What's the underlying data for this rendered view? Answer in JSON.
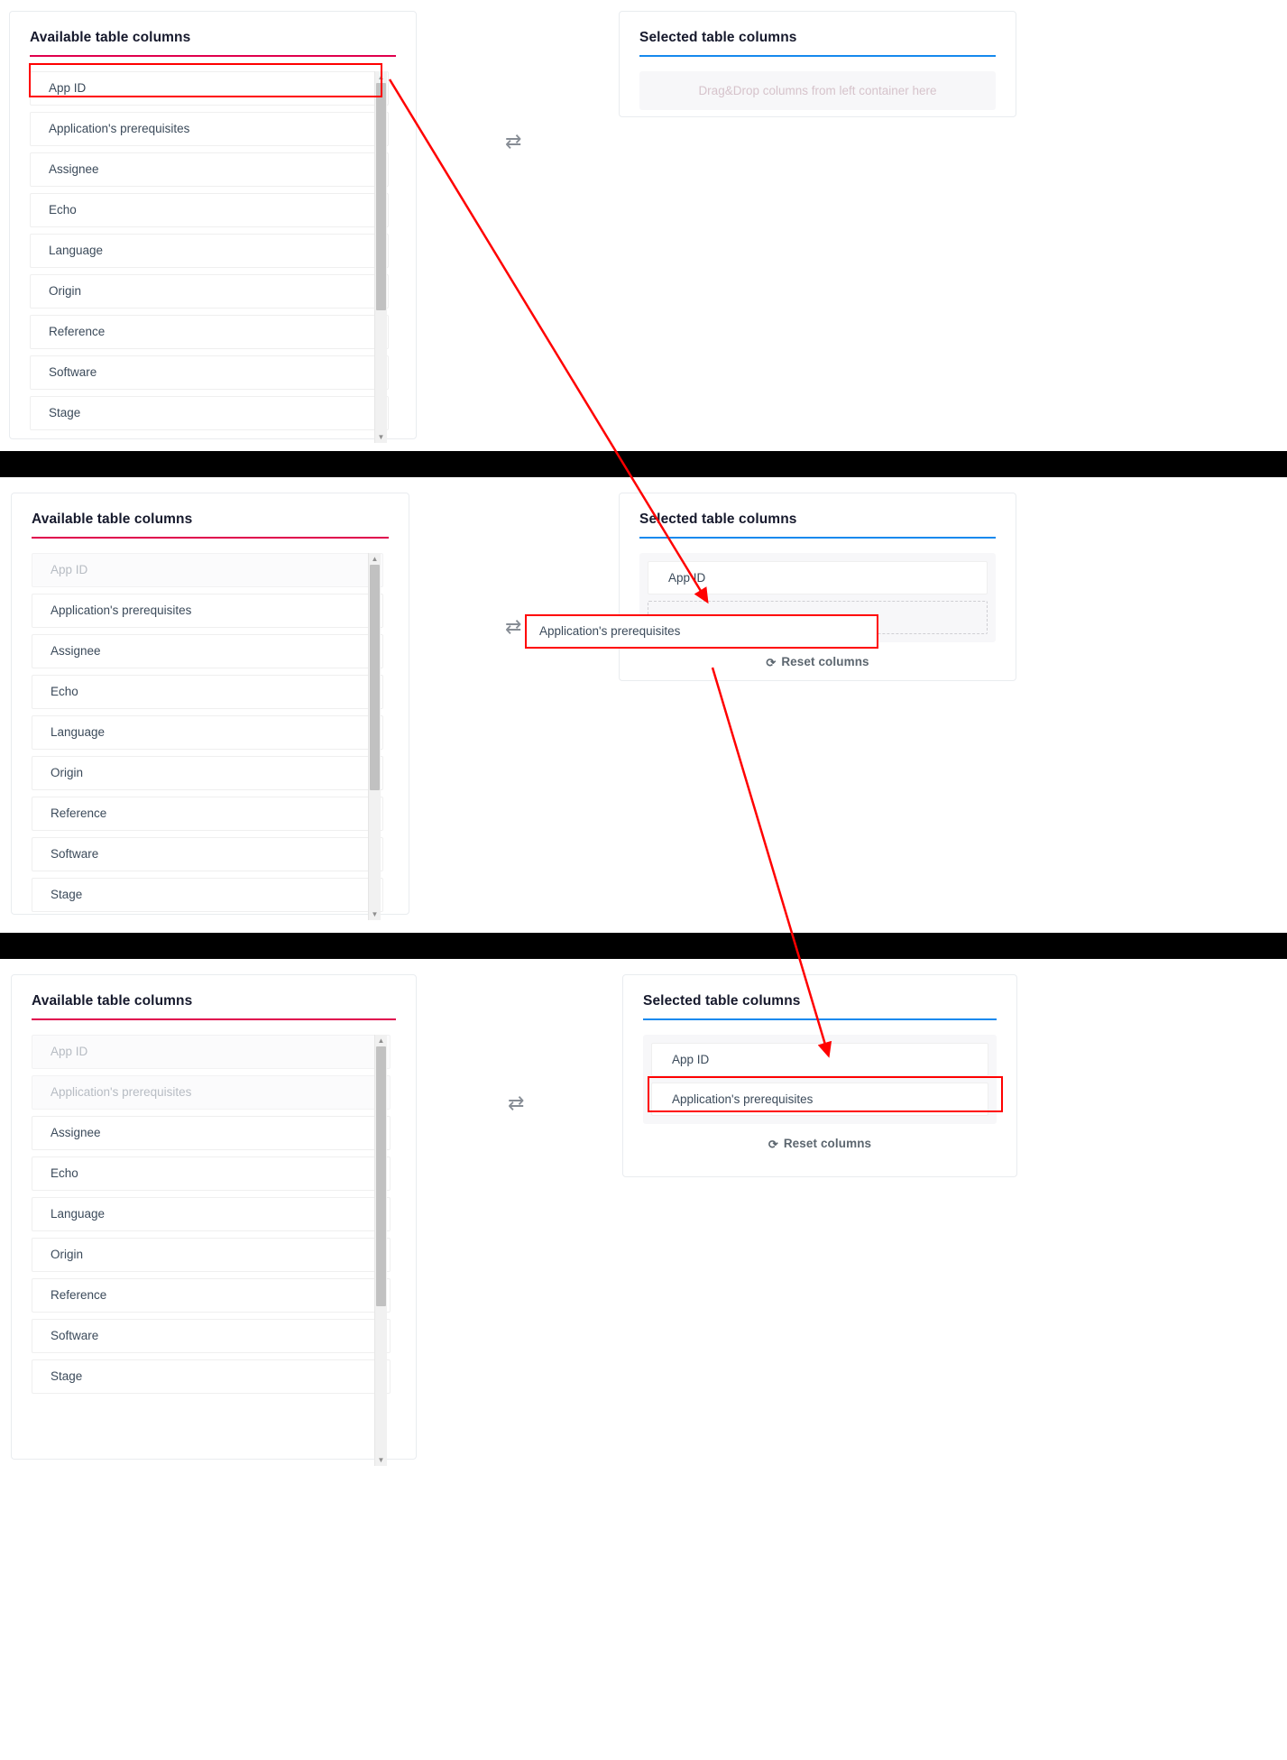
{
  "panels": {
    "available_title": "Available table columns",
    "selected_title": "Selected table columns",
    "dropzone_placeholder": "Drag&Drop columns from left container here",
    "reset_label": "Reset columns",
    "swap_icon": "⇄",
    "reset_icon": "⟳",
    "scroll_up_icon": "▲",
    "scroll_down_icon": "▼"
  },
  "colors": {
    "available_rule": "#e0004d",
    "selected_rule": "#1589ee",
    "annotation": "#ff0000",
    "item_text": "#3b4a5a",
    "disabled_text": "#b7bcc3",
    "placeholder_text": "#d6c3cb"
  },
  "columns": [
    "App ID",
    "Application's prerequisites",
    "Assignee",
    "Echo",
    "Language",
    "Origin",
    "Reference",
    "Software",
    "Stage"
  ],
  "steps": [
    {
      "id": "step-1",
      "available": [
        {
          "label": "App ID",
          "disabled": false,
          "highlighted": true
        },
        {
          "label": "Application's prerequisites",
          "disabled": false,
          "highlighted": false
        },
        {
          "label": "Assignee",
          "disabled": false,
          "highlighted": false
        },
        {
          "label": "Echo",
          "disabled": false,
          "highlighted": false
        },
        {
          "label": "Language",
          "disabled": false,
          "highlighted": false
        },
        {
          "label": "Origin",
          "disabled": false,
          "highlighted": false
        },
        {
          "label": "Reference",
          "disabled": false,
          "highlighted": false
        },
        {
          "label": "Software",
          "disabled": false,
          "highlighted": false
        },
        {
          "label": "Stage",
          "disabled": false,
          "highlighted": false
        }
      ],
      "selected": [],
      "dropzone_empty": true,
      "show_reset": false
    },
    {
      "id": "step-2",
      "available": [
        {
          "label": "App ID",
          "disabled": true,
          "highlighted": false
        },
        {
          "label": "Application's prerequisites",
          "disabled": false,
          "highlighted": false
        },
        {
          "label": "Assignee",
          "disabled": false,
          "highlighted": false
        },
        {
          "label": "Echo",
          "disabled": false,
          "highlighted": false
        },
        {
          "label": "Language",
          "disabled": false,
          "highlighted": false
        },
        {
          "label": "Origin",
          "disabled": false,
          "highlighted": false
        },
        {
          "label": "Reference",
          "disabled": false,
          "highlighted": false
        },
        {
          "label": "Software",
          "disabled": false,
          "highlighted": false
        },
        {
          "label": "Stage",
          "disabled": false,
          "highlighted": false
        }
      ],
      "selected": [
        {
          "label": "App ID",
          "highlighted": false
        }
      ],
      "dropzone_empty": false,
      "show_drop_slot": true,
      "show_reset": true,
      "drag_ghost_label": "Application's prerequisites"
    },
    {
      "id": "step-3",
      "available": [
        {
          "label": "App ID",
          "disabled": true,
          "highlighted": false
        },
        {
          "label": "Application's prerequisites",
          "disabled": true,
          "highlighted": false
        },
        {
          "label": "Assignee",
          "disabled": false,
          "highlighted": false
        },
        {
          "label": "Echo",
          "disabled": false,
          "highlighted": false
        },
        {
          "label": "Language",
          "disabled": false,
          "highlighted": false
        },
        {
          "label": "Origin",
          "disabled": false,
          "highlighted": false
        },
        {
          "label": "Reference",
          "disabled": false,
          "highlighted": false
        },
        {
          "label": "Software",
          "disabled": false,
          "highlighted": false
        },
        {
          "label": "Stage",
          "disabled": false,
          "highlighted": false
        }
      ],
      "selected": [
        {
          "label": "App ID",
          "highlighted": false
        },
        {
          "label": "Application's prerequisites",
          "highlighted": true
        }
      ],
      "dropzone_empty": false,
      "show_drop_slot": false,
      "show_reset": true
    }
  ]
}
